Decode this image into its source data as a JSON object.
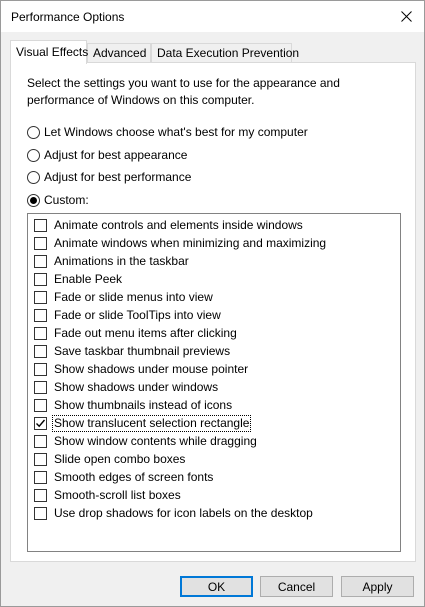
{
  "window": {
    "title": "Performance Options"
  },
  "tabs": [
    {
      "label": "Visual Effects",
      "active": true
    },
    {
      "label": "Advanced",
      "active": false
    },
    {
      "label": "Data Execution Prevention",
      "active": false
    }
  ],
  "description": "Select the settings you want to use for the appearance and performance of Windows on this computer.",
  "radios": [
    {
      "label": "Let Windows choose what's best for my computer",
      "checked": false
    },
    {
      "label": "Adjust for best appearance",
      "checked": false
    },
    {
      "label": "Adjust for best performance",
      "checked": false
    },
    {
      "label": "Custom:",
      "checked": true
    }
  ],
  "options": [
    {
      "label": "Animate controls and elements inside windows",
      "checked": false
    },
    {
      "label": "Animate windows when minimizing and maximizing",
      "checked": false
    },
    {
      "label": "Animations in the taskbar",
      "checked": false
    },
    {
      "label": "Enable Peek",
      "checked": false
    },
    {
      "label": "Fade or slide menus into view",
      "checked": false
    },
    {
      "label": "Fade or slide ToolTips into view",
      "checked": false
    },
    {
      "label": "Fade out menu items after clicking",
      "checked": false
    },
    {
      "label": "Save taskbar thumbnail previews",
      "checked": false
    },
    {
      "label": "Show shadows under mouse pointer",
      "checked": false
    },
    {
      "label": "Show shadows under windows",
      "checked": false
    },
    {
      "label": "Show thumbnails instead of icons",
      "checked": false
    },
    {
      "label": "Show translucent selection rectangle",
      "checked": true
    },
    {
      "label": "Show window contents while dragging",
      "checked": false
    },
    {
      "label": "Slide open combo boxes",
      "checked": false
    },
    {
      "label": "Smooth edges of screen fonts",
      "checked": false
    },
    {
      "label": "Smooth-scroll list boxes",
      "checked": false
    },
    {
      "label": "Use drop shadows for icon labels on the desktop",
      "checked": false
    }
  ],
  "buttons": {
    "ok": "OK",
    "cancel": "Cancel",
    "apply": "Apply"
  },
  "colors": {
    "default_button_border": "#0078d7",
    "button_face": "#e1e1e1",
    "window_bg": "#f0f0f0"
  }
}
